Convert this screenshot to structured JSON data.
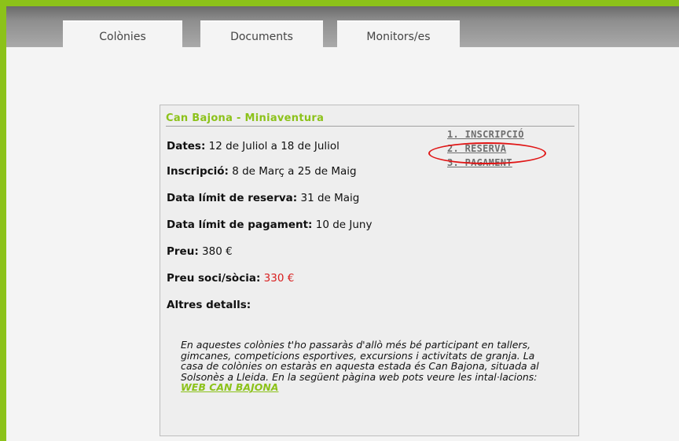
{
  "nav": {
    "tabs": [
      {
        "label": "Colònies"
      },
      {
        "label": "Documents"
      },
      {
        "label": "Monitors/es"
      }
    ]
  },
  "card": {
    "title": "Can Bajona - Miniaventura",
    "fields": {
      "dates": {
        "label": "Dates:",
        "value": "12 de Juliol a 18 de Juliol"
      },
      "inscripcio": {
        "label": "Inscripció:",
        "value": "8 de Març a 25 de Maig"
      },
      "limit_reserva": {
        "label": "Data límit de reserva:",
        "value": "31 de Maig"
      },
      "limit_pagament": {
        "label": "Data límit de pagament:",
        "value": "10 de Juny"
      },
      "preu": {
        "label": "Preu:",
        "value": "380 €"
      },
      "preu_soci": {
        "label": "Preu soci/sòcia:",
        "value": "330 €"
      },
      "altres": {
        "label": "Altres detalls:"
      }
    },
    "steps": [
      {
        "label": "1. INSCRIPCIÓ"
      },
      {
        "label": "2. RESERVA"
      },
      {
        "label": "3. PAGAMENT"
      }
    ],
    "description": {
      "text": "En aquestes colònies t'ho passaràs d'allò més bé participant en tallers, gimcanes, competicions esportives, excursions i activitats de granja. La casa de colònies on estaràs en aquesta estada és Can Bajona, situada al Solsonès a Lleida. En la següent pàgina web pots veure les intal·lacions: ",
      "link": "WEB CAN BAJONA"
    }
  },
  "colors": {
    "accent": "#8cc21a",
    "price_highlight": "#d81e1e",
    "annotation": "#e01515"
  }
}
